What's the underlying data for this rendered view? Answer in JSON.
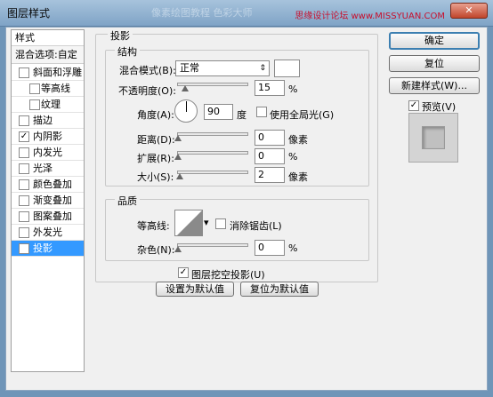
{
  "window": {
    "title": "图层样式",
    "ghost_title": "像素绘图教程 色彩大师",
    "watermark": "思缘设计论坛 www.MISSYUAN.COM",
    "close_label": "✕"
  },
  "left_panel": {
    "header": "样式",
    "blend_options": "混合选项:自定",
    "items": [
      {
        "label": "斜面和浮雕",
        "checked": false,
        "sub": false
      },
      {
        "label": "等高线",
        "checked": false,
        "sub": true
      },
      {
        "label": "纹理",
        "checked": false,
        "sub": true
      },
      {
        "label": "描边",
        "checked": false,
        "sub": false
      },
      {
        "label": "内阴影",
        "checked": true,
        "sub": false
      },
      {
        "label": "内发光",
        "checked": false,
        "sub": false
      },
      {
        "label": "光泽",
        "checked": false,
        "sub": false
      },
      {
        "label": "颜色叠加",
        "checked": false,
        "sub": false
      },
      {
        "label": "渐变叠加",
        "checked": false,
        "sub": false
      },
      {
        "label": "图案叠加",
        "checked": false,
        "sub": false
      },
      {
        "label": "外发光",
        "checked": false,
        "sub": false
      },
      {
        "label": "投影",
        "checked": true,
        "sub": false,
        "selected": true
      }
    ]
  },
  "shadow": {
    "section_title": "投影",
    "structure_title": "结构",
    "blend_mode_label": "混合模式(B):",
    "blend_mode_value": "正常",
    "blend_mode_arrow": "⇕",
    "opacity_label": "不透明度(O):",
    "opacity_value": "15",
    "opacity_unit": "%",
    "angle_label": "角度(A):",
    "angle_value": "90",
    "angle_unit": "度",
    "global_light_label": "使用全局光(G)",
    "distance_label": "距离(D):",
    "distance_value": "0",
    "distance_unit": "像素",
    "spread_label": "扩展(R):",
    "spread_value": "0",
    "spread_unit": "%",
    "size_label": "大小(S):",
    "size_value": "2",
    "size_unit": "像素",
    "quality_title": "品质",
    "contour_label": "等高线:",
    "contour_arrow": "▾",
    "antialias_label": "消除锯齿(L)",
    "noise_label": "杂色(N):",
    "noise_value": "0",
    "noise_unit": "%",
    "knockout_label": "图层挖空投影(U)",
    "knockout_check": "✓",
    "make_default": "设置为默认值",
    "reset_default": "复位为默认值"
  },
  "actions": {
    "ok": "确定",
    "reset": "复位",
    "new_style": "新建样式(W)...",
    "preview_label": "预览(V)",
    "preview_check": "✓"
  },
  "check_mark": "✓"
}
